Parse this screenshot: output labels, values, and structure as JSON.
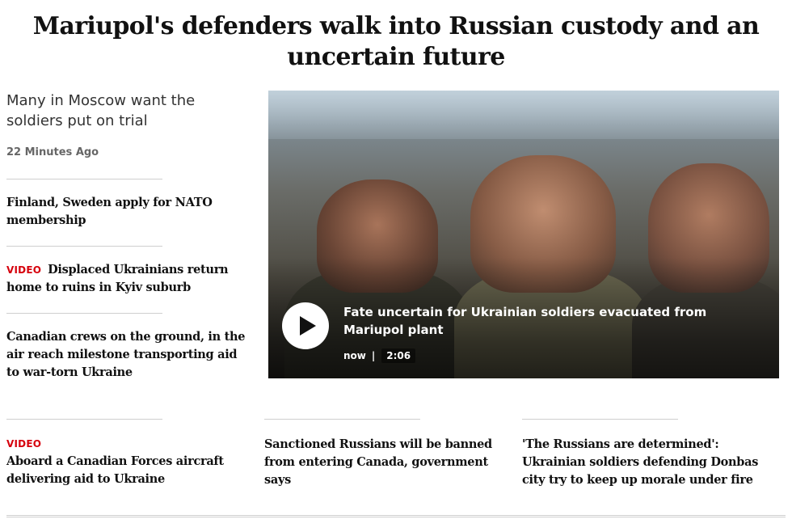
{
  "main_story": {
    "headline": "Mariupol's defenders walk into Russian custody and an uncertain future",
    "subhead": "Many in Moscow want the soldiers put on trial",
    "timestamp": "22 Minutes Ago"
  },
  "sidebar_stories": [
    {
      "title": "Finland, Sweden apply for NATO membership",
      "tag": ""
    },
    {
      "title": "Displaced Ukrainians return home to ruins in Kyiv suburb",
      "tag": "VIDEO"
    },
    {
      "title": "Canadian crews on the ground, in the air reach milestone transporting aid to war-torn Ukraine",
      "tag": ""
    }
  ],
  "hero_video": {
    "caption": "Fate uncertain for Ukrainian soldiers evacuated from Mariupol plant",
    "time_label": "now",
    "separator": "|",
    "duration": "2:06"
  },
  "bottom_stories": [
    {
      "title": "Aboard a Canadian Forces aircraft delivering aid to Ukraine",
      "tag": "VIDEO"
    },
    {
      "title": "Sanctioned Russians will be banned from entering Canada, government says",
      "tag": ""
    },
    {
      "title": "'The Russians are determined': Ukrainian soldiers defending Donbas city try to keep up morale under fire",
      "tag": ""
    }
  ],
  "colors": {
    "video_tag": "#d6000c",
    "text": "#111111",
    "muted": "#666666",
    "rule": "#cfcfcf"
  },
  "icons": {
    "play": "play-icon"
  }
}
